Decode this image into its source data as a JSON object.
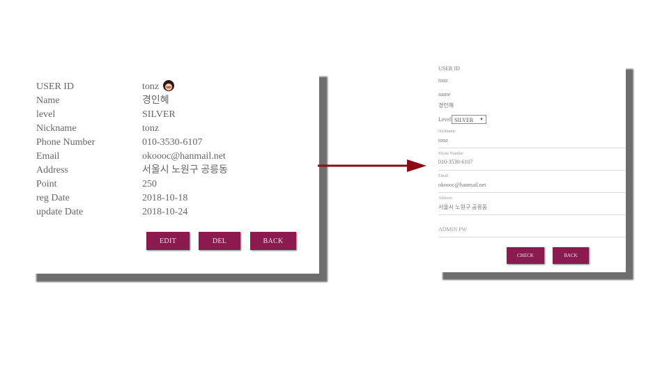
{
  "detail": {
    "fields": [
      {
        "label": "USER ID",
        "value": "tonz"
      },
      {
        "label": "Name",
        "value": "경인혜"
      },
      {
        "label": "level",
        "value": "SILVER"
      },
      {
        "label": "Nickname",
        "value": "tonz"
      },
      {
        "label": "Phone Number",
        "value": "010-3530-6107"
      },
      {
        "label": "Email",
        "value": "okoooc@hanmail.net"
      },
      {
        "label": "Address",
        "value": "서울시 노원구 공릉동"
      },
      {
        "label": "Point",
        "value": "250"
      },
      {
        "label": "reg Date",
        "value": "2018-10-18"
      },
      {
        "label": "update Date",
        "value": "2018-10-24"
      }
    ],
    "buttons": {
      "edit": "EDIT",
      "del": "DEL",
      "back": "BACK"
    }
  },
  "edit_form": {
    "user_id_label": "USER ID",
    "user_id_value": "tonz",
    "name_label": "name",
    "name_value": "경인혜",
    "level_label": "Level",
    "level_selected": "SILVER",
    "nickname_label": "Nickname",
    "nickname_value": "tonz",
    "phone_label": "Phone Number",
    "phone_value": "010-3530-6107",
    "email_label": "Email",
    "email_value": "okoooc@hanmail.net",
    "address_label": "Address",
    "address_value": "서울시 노원구 공릉동",
    "admin_pw_placeholder": "ADMIN PW",
    "buttons": {
      "check": "CHECK",
      "back": "BACK"
    }
  },
  "colors": {
    "button": "#8b1a4e",
    "arrow": "#8b0a14",
    "shadow": "#6e6e6e"
  },
  "icons": {
    "avatar": "user-avatar-icon",
    "arrow": "right-arrow-icon",
    "select": "dropdown-caret-icon"
  }
}
